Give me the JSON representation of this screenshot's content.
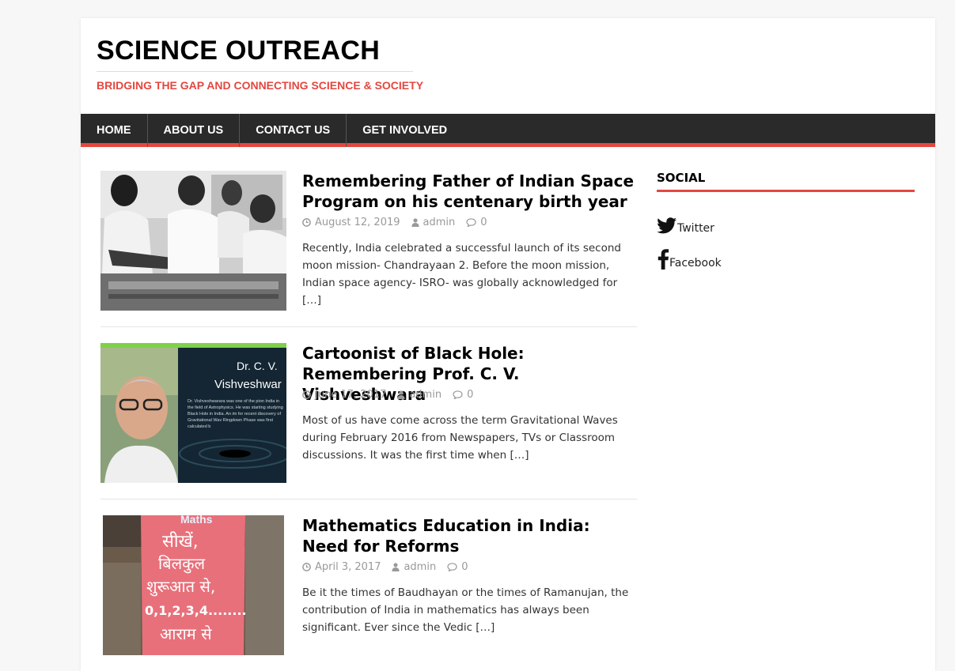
{
  "site": {
    "title": "SCIENCE OUTREACH",
    "tagline": "BRIDGING THE GAP AND CONNECTING SCIENCE & SOCIETY"
  },
  "nav": {
    "items": [
      {
        "label": "HOME"
      },
      {
        "label": "ABOUT US"
      },
      {
        "label": "CONTACT US"
      },
      {
        "label": "GET INVOLVED"
      }
    ]
  },
  "posts": [
    {
      "title": "Remembering Father of Indian Space Program on his centenary birth year",
      "date": "August 12, 2019",
      "author": "admin",
      "comments": "0",
      "excerpt": "Recently, India celebrated a successful launch of its second moon mission- Chandrayaan 2. Before the moon mission, Indian space agency- ISRO- was globally acknowledged for […]"
    },
    {
      "title": "Cartoonist of Black Hole: Remembering Prof. C. V. Vishveshwara",
      "date": "June 17, 2017",
      "author": "admin",
      "comments": "0",
      "excerpt": "Most of us have come across the term Gravitational Waves during February 2016 from Newspapers, TVs or Classroom discussions. It was the first time when […]",
      "image_text": {
        "heading1": "Dr. C. V.",
        "heading2": "Vishveshwar",
        "body": "Dr. Vishveshwarara was one of the pion India in the field of Astrophysics. He was starting studying Black Hole in India. An im for recent discovery of Gravitational Wav Ringdown Phase was first calculated b"
      }
    },
    {
      "title": "Mathematics Education in India: Need for Reforms",
      "date": "April 3, 2017",
      "author": "admin",
      "comments": "0",
      "excerpt": "Be it the times of Baudhayan or the times of Ramanujan, the contribution of India in mathematics has always been significant. Ever since the Vedic […]",
      "image_text": {
        "top": "Maths",
        "line1": "सीखें,",
        "line2": "बिलकुल",
        "line3": "शुरूआत से,",
        "line4": "0,1,2,3,4........",
        "line5": "आराम से"
      }
    }
  ],
  "sidebar": {
    "widget_title": "SOCIAL",
    "links": [
      {
        "label": "Twitter",
        "icon": "twitter-icon"
      },
      {
        "label": "Facebook",
        "icon": "facebook-icon"
      }
    ]
  },
  "colors": {
    "accent": "#e4473f",
    "nav_bg": "#2a2a2a",
    "page_bg": "#f7f7f7"
  }
}
